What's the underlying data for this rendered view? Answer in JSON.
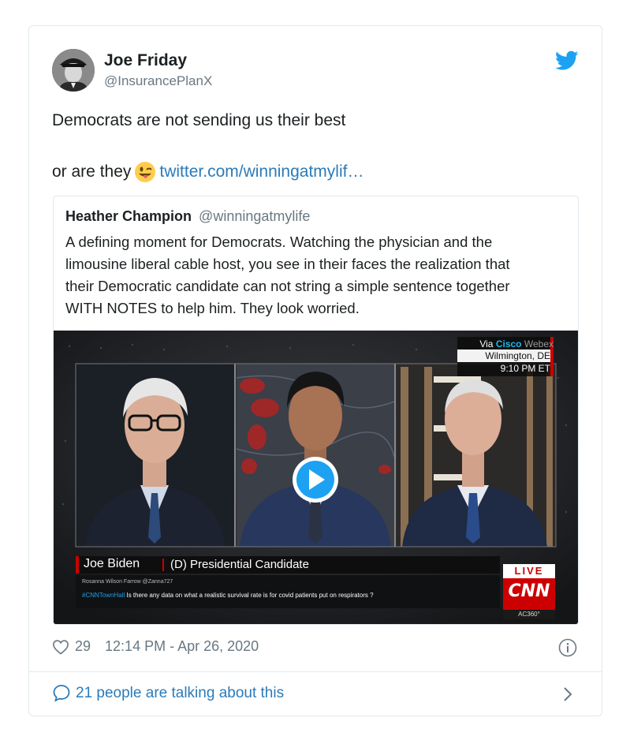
{
  "tweet": {
    "author_name": "Joe Friday",
    "author_handle": "@InsurancePlanX",
    "text_line1": "Democrats are not sending us their best",
    "text_line2_prefix": "or are they",
    "emoji": "winking-face-with-tongue",
    "link_text": "twitter.com/winningatmylif…"
  },
  "quoted_tweet": {
    "author_name": "Heather Champion",
    "author_handle": "@winningatmylife",
    "body_lines": [
      "A defining moment for Democrats. Watching the physician and the",
      "limousine liberal cable host, you see in their faces the realization that",
      "their Democratic candidate can not string a simple sentence together",
      "WITH NOTES to help him. They look worried."
    ],
    "media": {
      "type": "video",
      "via_prefix": "Via",
      "via_brand": "Cisco",
      "via_suffix": "Webex",
      "location": "Wilmington, DE",
      "time": "9:10 PM ET",
      "lower_third_name": "Joe Biden",
      "lower_third_role": "(D) Presidential Candidate",
      "ticker_user": "Rosanna Wilson Farrow @Zanna727",
      "ticker_hashtag": "#CNNTownHall",
      "ticker_text": "Is there any data on what a realistic survival rate is for covid patients put on respirators ?",
      "live_label": "LIVE",
      "network_logo": "CNN",
      "show_label": "AC360°"
    }
  },
  "meta": {
    "like_count": "29",
    "timestamp": "12:14 PM - Apr 26, 2020"
  },
  "conversation": {
    "label": "21 people are talking about this"
  },
  "colors": {
    "link": "#2b7bb9",
    "twitter_blue": "#1da1f2",
    "secondary_text": "#697882",
    "border": "#e1e8ed",
    "cnn_red": "#cc0000"
  }
}
